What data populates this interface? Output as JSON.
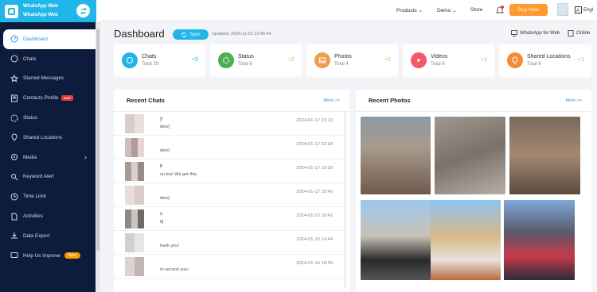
{
  "app": {
    "name1": "WhatsApp Web",
    "name2": "WhatsApp Web"
  },
  "sidebar": {
    "items": [
      {
        "label": "Dashboard",
        "icon": "dashboard-icon"
      },
      {
        "label": "Chats",
        "icon": "chat-icon"
      },
      {
        "label": "Starred Messages",
        "icon": "star-icon"
      },
      {
        "label": "Contacts Profile",
        "icon": "contact-icon",
        "badge": "HOT"
      },
      {
        "label": "Status",
        "icon": "status-icon"
      },
      {
        "label": "Shared Locations",
        "icon": "location-icon"
      },
      {
        "label": "Media",
        "icon": "media-icon"
      },
      {
        "label": "Keyword Alert",
        "icon": "keyword-icon"
      },
      {
        "label": "Time Limit",
        "icon": "clock-icon"
      },
      {
        "label": "Activities",
        "icon": "activities-icon"
      },
      {
        "label": "Data Export",
        "icon": "export-icon"
      },
      {
        "label": "Help Us Improve",
        "icon": "help-icon",
        "badge": "New"
      }
    ]
  },
  "topbar": {
    "products": "Products",
    "demo": "Demo",
    "store": "Store",
    "buy": "Buy Now",
    "lang": "Engl"
  },
  "header": {
    "title": "Dashboard",
    "sync": "Sync",
    "updated": "Updated: 2024-11-01 13:45:44",
    "whatsapp_for_web": "WhatsApp for Web",
    "online": "Online"
  },
  "cards": [
    {
      "name": "Chats",
      "total": "Total   29",
      "plus": "+5",
      "color": "#21b6e8"
    },
    {
      "name": "Status",
      "total": "Total   8",
      "plus": "+2",
      "color": "#4caf50"
    },
    {
      "name": "Photos",
      "total": "Total   4",
      "plus": "+2",
      "color": "#f0a04b"
    },
    {
      "name": "Videos",
      "total": "Total   6",
      "plus": "+1",
      "color": "#f4576a"
    },
    {
      "name": "Shared Locations",
      "total": "Total   6",
      "plus": "+1",
      "color": "#f28c38"
    }
  ],
  "recent_chats": {
    "title": "Recent Chats",
    "more": "More >>",
    "rows": [
      {
        "name": "y",
        "msg": "ideo]",
        "time": "2024-01-17 23:10"
      },
      {
        "name": "",
        "msg": "ideo]",
        "time": "2024-01-17 22:34"
      },
      {
        "name": "h",
        "msg": "ou too! We got this.",
        "time": "2024-01-17 10:39"
      },
      {
        "name": "",
        "msg": "ideo]",
        "time": "2024-01-17 15:40"
      },
      {
        "name": "s",
        "msg": "if]",
        "time": "2024-01-15 20:42"
      },
      {
        "name": "",
        "msg": "hank you!",
        "time": "2024-01-15 14:44"
      },
      {
        "name": "",
        "msg": "m second you!",
        "time": "2024-01-14 18:39"
      }
    ]
  },
  "recent_photos": {
    "title": "Recent Photos",
    "more": "More >>"
  }
}
